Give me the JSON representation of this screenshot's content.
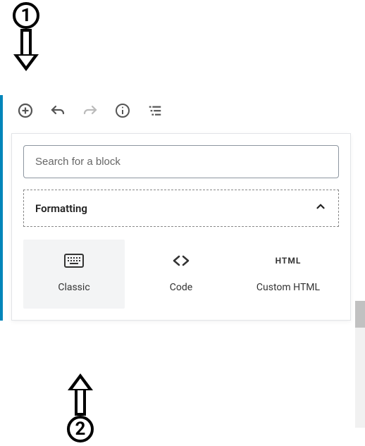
{
  "annotations": {
    "one": "1",
    "two": "2"
  },
  "toolbar": {
    "add_block_tooltip": "Add block",
    "undo_tooltip": "Undo",
    "redo_tooltip": "Redo",
    "info_tooltip": "Content structure",
    "outline_tooltip": "Block navigation"
  },
  "inserter": {
    "search_placeholder": "Search for a block",
    "category_label": "Formatting",
    "blocks": [
      {
        "name": "classic",
        "label": "Classic"
      },
      {
        "name": "code",
        "label": "Code"
      },
      {
        "name": "custom-html",
        "label": "Custom HTML",
        "icon_text": "HTML"
      }
    ]
  }
}
